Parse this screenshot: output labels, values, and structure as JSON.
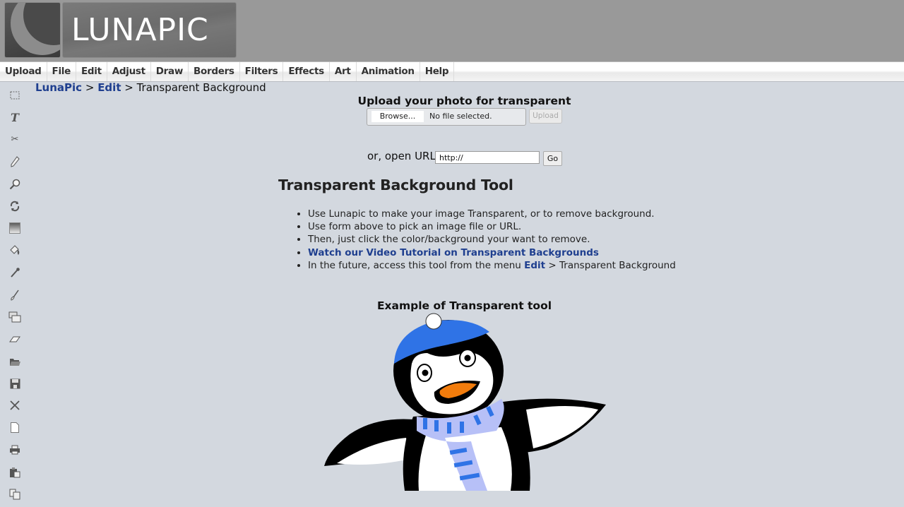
{
  "header": {
    "logo_text": "LUNAPIC"
  },
  "menu": [
    {
      "label": "Upload"
    },
    {
      "label": "File"
    },
    {
      "label": "Edit"
    },
    {
      "label": "Adjust"
    },
    {
      "label": "Draw"
    },
    {
      "label": "Borders"
    },
    {
      "label": "Filters"
    },
    {
      "label": "Effects"
    },
    {
      "label": "Art"
    },
    {
      "label": "Animation"
    },
    {
      "label": "Help"
    }
  ],
  "toolbar": [
    {
      "icon": "marquee-select-icon",
      "glyph": "⬚"
    },
    {
      "icon": "text-tool-icon",
      "glyph": "T"
    },
    {
      "icon": "scissors-icon",
      "glyph": "✂"
    },
    {
      "icon": "pencil-icon",
      "glyph": "✎"
    },
    {
      "icon": "magnifier-icon",
      "glyph": "⚲"
    },
    {
      "icon": "rotate-icon",
      "glyph": "⟳"
    },
    {
      "icon": "gradient-icon",
      "glyph": "▤"
    },
    {
      "icon": "paint-bucket-icon",
      "glyph": "⛀"
    },
    {
      "icon": "eyedropper-icon",
      "glyph": "⁄"
    },
    {
      "icon": "brush-icon",
      "glyph": "⌇"
    },
    {
      "icon": "layers-icon",
      "glyph": "❐"
    },
    {
      "icon": "eraser-icon",
      "glyph": "▱"
    },
    {
      "icon": "open-folder-icon",
      "glyph": "📂"
    },
    {
      "icon": "save-disk-icon",
      "glyph": "💾"
    },
    {
      "icon": "close-x-icon",
      "glyph": "✕"
    },
    {
      "icon": "new-document-icon",
      "glyph": "🗋"
    },
    {
      "icon": "print-icon",
      "glyph": "⎙"
    },
    {
      "icon": "paste-icon",
      "glyph": "📋"
    },
    {
      "icon": "copy-icon",
      "glyph": "⧉"
    }
  ],
  "breadcrumb": {
    "home": "LunaPic",
    "sep1": " > ",
    "section": "Edit",
    "sep2": " > ",
    "current": "Transparent Background"
  },
  "upload": {
    "title": "Upload your photo for transparent",
    "browse_label": "Browse...",
    "file_status": "No file selected.",
    "upload_label": "Upload",
    "url_label": "or, open URL",
    "url_value": "http://",
    "go_label": "Go"
  },
  "tool": {
    "title": "Transparent Background Tool",
    "bullets": {
      "b1": "Use Lunapic to make your image Transparent, or to remove background.",
      "b2": "Use form above to pick an image file or URL.",
      "b3": "Then, just click the color/background your want to remove.",
      "b4_link": "Watch our Video Tutorial on Transparent Backgrounds",
      "b5_prefix": "In the future, access this tool from the menu ",
      "b5_link": "Edit",
      "b5_suffix": " > Transparent Background"
    }
  },
  "example": {
    "title": "Example of Transparent tool"
  },
  "colors": {
    "link": "#1f3f8f",
    "background": "#d3d8df",
    "header": "#999999",
    "hat_blue": "#2f73e6",
    "scarf_light": "#b7c0f7",
    "beak_orange": "#f27c0c"
  }
}
